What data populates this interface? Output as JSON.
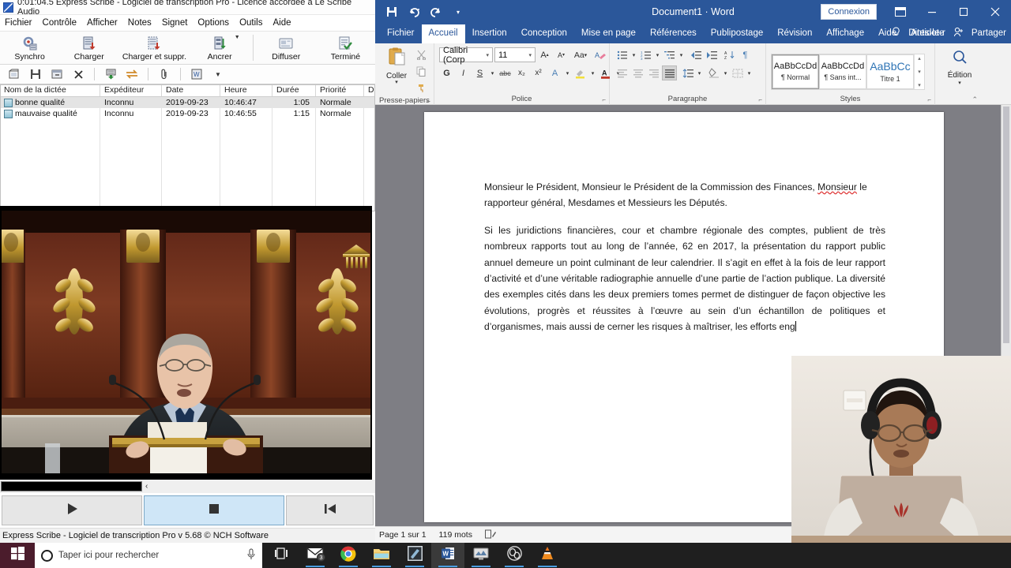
{
  "scribe": {
    "title": "0:01:04.5 Express Scribe - Logiciel de transcription Pro - Licence accordée à Le Scribe Audio",
    "title_icon": "express-scribe-logo",
    "menu": [
      "Fichier",
      "Contrôle",
      "Afficher",
      "Notes",
      "Signet",
      "Options",
      "Outils",
      "Aide"
    ],
    "ribbon": [
      {
        "label": "Synchro",
        "icon": "sync-gear-icon"
      },
      {
        "label": "Charger",
        "icon": "load-icon"
      },
      {
        "label": "Charger et suppr.",
        "icon": "load-delete-icon"
      },
      {
        "label": "Ancrer",
        "icon": "dock-icon"
      },
      {
        "label": "Diffuser",
        "icon": "broadcast-icon"
      },
      {
        "label": "Terminé",
        "icon": "done-check-icon"
      }
    ],
    "toolbar_icons": [
      "open-folder-icon",
      "save-icon",
      "archive-icon",
      "delete-x-icon",
      "send-down-icon",
      "transfer-icon",
      "attach-clip-icon",
      "word-export-icon",
      "dropdown-caret-icon"
    ],
    "list": {
      "columns": [
        "Nom de la dictée",
        "Expéditeur",
        "Date",
        "Heure",
        "Durée",
        "Priorité",
        "Da"
      ],
      "rows": [
        {
          "name": "bonne qualité",
          "sender": "Inconnu",
          "date": "2019-09-23",
          "time": "10:46:47",
          "duration": "1:05",
          "priority": "Normale",
          "extra": ""
        },
        {
          "name": "mauvaise qualité",
          "sender": "Inconnu",
          "date": "2019-09-23",
          "time": "10:46:55",
          "duration": "1:15",
          "priority": "Normale",
          "extra": ""
        }
      ]
    },
    "transport": {
      "scrub_mark": "‹",
      "play_icon": "play-icon",
      "stop_icon": "stop-icon",
      "rewind_icon": "rewind-to-start-icon"
    },
    "status": "Express Scribe - Logiciel de transcription Pro v 5.68 © NCH Software",
    "video_caption": "assemblee-nationale-speaker-video"
  },
  "word": {
    "doc_title": "Document1  ·  Word",
    "quick_access": [
      "save-icon",
      "undo-icon",
      "redo-icon",
      "customize-qat-icon"
    ],
    "sign_in": "Connexion",
    "window_buttons": [
      "ribbon-display-options-icon",
      "minimize-icon",
      "restore-icon",
      "close-icon"
    ],
    "tabs": [
      "Fichier",
      "Accueil",
      "Insertion",
      "Conception",
      "Mise en page",
      "Références",
      "Publipostage",
      "Révision",
      "Affichage",
      "Aide",
      "Antidote"
    ],
    "active_tab": "Accueil",
    "tell_me": "Dites-le-r",
    "share": "Partager",
    "groups": {
      "clipboard": {
        "name": "Presse-papiers",
        "paste_label": "Coller",
        "buttons": [
          "cut-scissors-icon",
          "copy-icon",
          "format-painter-icon"
        ]
      },
      "font": {
        "name": "Police",
        "font_name": "Calibri (Corp",
        "font_size": "11",
        "buttons": [
          "grow-font-icon",
          "shrink-font-icon",
          "change-case-icon",
          "clear-formatting-icon",
          "bold-icon",
          "italic-icon",
          "underline-icon",
          "strikethrough-icon",
          "subscript-icon",
          "superscript-icon",
          "text-effects-icon",
          "highlight-icon",
          "font-color-icon"
        ],
        "bold_label": "G",
        "italic_label": "I",
        "underline_label": "S",
        "strike_label": "abc",
        "sub_label": "x₂",
        "sup_label": "x²",
        "case_label": "Aa"
      },
      "paragraph": {
        "name": "Paragraphe",
        "buttons": [
          "bullets-icon",
          "numbering-icon",
          "multilevel-list-icon",
          "decrease-indent-icon",
          "increase-indent-icon",
          "sort-icon",
          "show-marks-icon",
          "align-left-icon",
          "align-center-icon",
          "align-right-icon",
          "justify-icon",
          "line-spacing-icon",
          "shading-icon",
          "borders-icon"
        ]
      },
      "styles": {
        "name": "Styles",
        "items": [
          {
            "preview": "AaBbCcDd",
            "name": "¶ Normal",
            "selected": true
          },
          {
            "preview": "AaBbCcDd",
            "name": "¶ Sans int...",
            "selected": false
          },
          {
            "preview": "AaBbCc",
            "name": "Titre 1",
            "selected": false
          }
        ]
      },
      "editing": {
        "name": "Édition",
        "label": "Édition",
        "icon": "search-magnifier-icon"
      }
    },
    "document": {
      "paragraphs": [
        "Monsieur le Président, Monsieur le Président de la Commission des Finances, Monsieur le rapporteur général, Mesdames et Messieurs les Députés.",
        "Si les juridictions financières, cour et chambre régionale des comptes, publient de très nombreux rapports tout au long de l’année, 62 en 2017, la présentation du rapport public annuel demeure un point culminant de leur calendrier. Il s’agit en effet à la fois de leur rapport d’activité et d’une véritable radiographie annuelle d’une partie de l’action publique. La diversité des exemples cités dans les deux premiers tomes permet de distinguer de façon objective les évolutions, progrès et réussites à l’œuvre au sein d’un échantillon de politiques et d’organismes, mais aussi de cerner les risques à maîtriser, les efforts eng"
      ]
    },
    "status": {
      "page": "Page 1 sur 1",
      "words": "119 mots",
      "proofing_icon": "proofing-status-icon"
    }
  },
  "webcam": {
    "caption": "transcriber-webcam-feed"
  },
  "taskbar": {
    "start_icon": "windows-start-icon",
    "search_placeholder": "Taper ici pour rechercher",
    "cortana_icon": "cortana-ring-icon",
    "mic_icon": "microphone-icon",
    "items": [
      {
        "icon": "task-view-icon",
        "active": false,
        "open": false,
        "badge": ""
      },
      {
        "icon": "mail-icon",
        "active": false,
        "open": true,
        "badge": "3"
      },
      {
        "icon": "chrome-icon",
        "active": false,
        "open": true,
        "badge": ""
      },
      {
        "icon": "file-explorer-icon",
        "active": false,
        "open": true,
        "badge": ""
      },
      {
        "icon": "express-scribe-icon",
        "active": false,
        "open": true,
        "badge": ""
      },
      {
        "icon": "word-icon",
        "active": true,
        "open": true,
        "badge": ""
      },
      {
        "icon": "screen-capture-icon",
        "active": false,
        "open": true,
        "badge": ""
      },
      {
        "icon": "obs-studio-icon",
        "active": false,
        "open": true,
        "badge": ""
      },
      {
        "icon": "vlc-icon",
        "active": false,
        "open": true,
        "badge": ""
      }
    ]
  },
  "colors": {
    "word_blue": "#2b579a",
    "doc_gray": "#7e7e84",
    "selection": "#cfe6f7",
    "taskbar": "#1f1f1f"
  }
}
